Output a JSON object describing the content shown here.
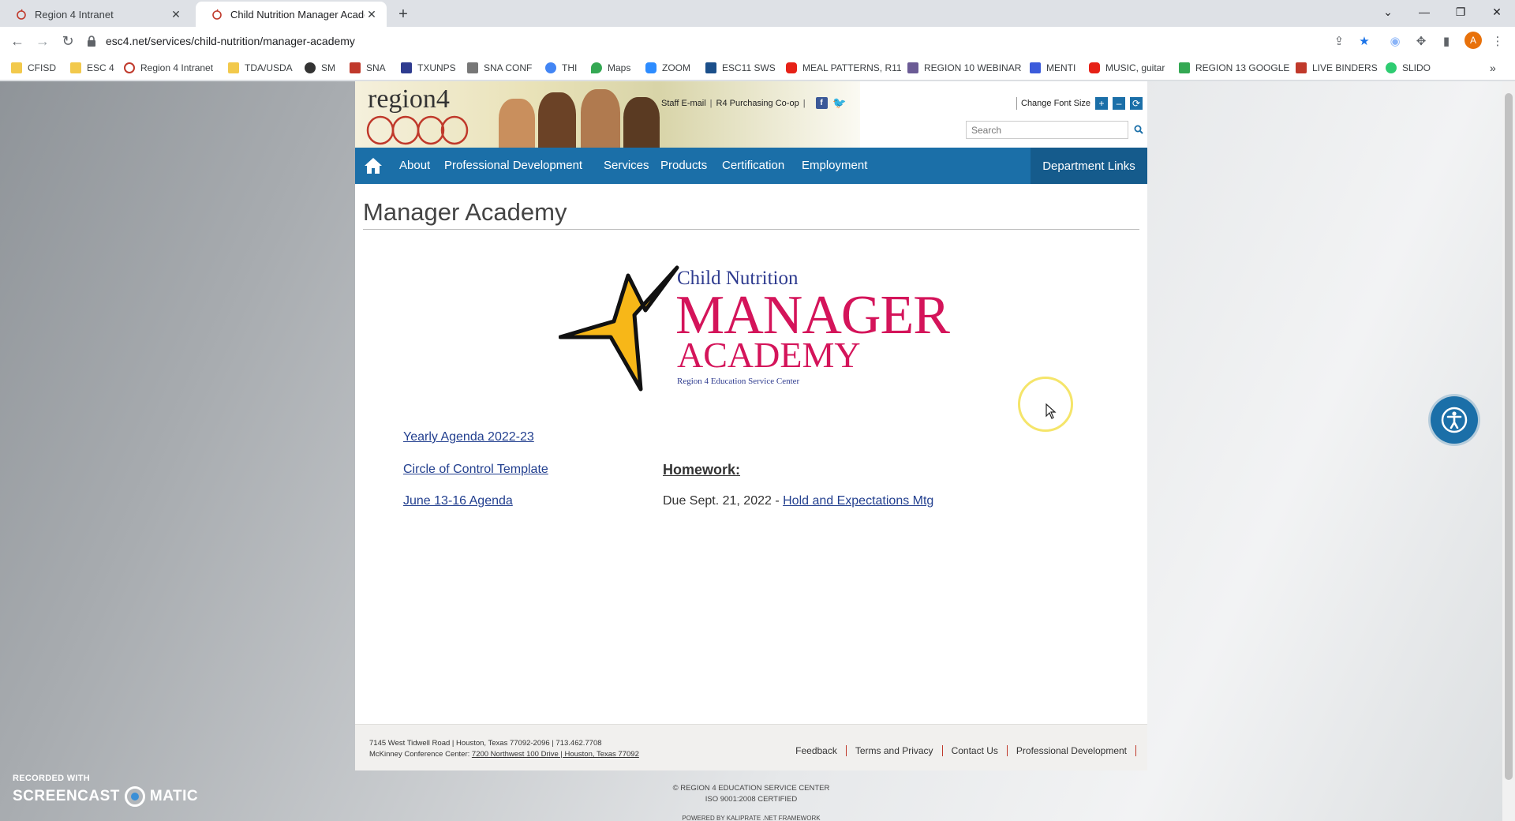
{
  "browser": {
    "tabs": [
      {
        "label": "Region 4 Intranet",
        "close": "✕"
      },
      {
        "label": "Child Nutrition Manager Academ",
        "close": "✕"
      }
    ],
    "new_tab": "+",
    "window_controls": {
      "dropdown": "⌄",
      "minimize": "—",
      "restore": "❐",
      "close": "✕"
    },
    "url": "esc4.net/services/child-nutrition/manager-academy",
    "profile_initial": "A",
    "bookmarks": [
      {
        "label": "CFISD",
        "color": "#f2c94c"
      },
      {
        "label": "ESC 4",
        "color": "#f2c94c"
      },
      {
        "label": "Region 4 Intranet",
        "color": "#c0392b"
      },
      {
        "label": "TDA/USDA",
        "color": "#f2c94c"
      },
      {
        "label": "SM",
        "color": "#333333"
      },
      {
        "label": "SNA",
        "color": "#c0392b"
      },
      {
        "label": "TXUNPS",
        "color": "#2e3b8f"
      },
      {
        "label": "SNA CONF",
        "color": "#555555"
      },
      {
        "label": "THI",
        "color": "#4285f4"
      },
      {
        "label": "Maps",
        "color": "#34a853"
      },
      {
        "label": "ZOOM",
        "color": "#2d8cff"
      },
      {
        "label": "ESC11 SWS",
        "color": "#1b4f8a"
      },
      {
        "label": "MEAL PATTERNS, R11",
        "color": "#e62117"
      },
      {
        "label": "REGION 10 WEBINAR",
        "color": "#6b5b95"
      },
      {
        "label": "MENTI",
        "color": "#3b5bdb"
      },
      {
        "label": "MUSIC, guitar",
        "color": "#e62117"
      },
      {
        "label": "REGION 13 GOOGLE",
        "color": "#34a853"
      },
      {
        "label": "LIVE BINDERS",
        "color": "#c0392b"
      },
      {
        "label": "SLIDO",
        "color": "#2ecc71"
      }
    ],
    "bookmarks_more": "»"
  },
  "site": {
    "logo_text": "region4",
    "top_links": [
      "Staff E-mail",
      "R4 Purchasing Co-op"
    ],
    "change_font_size": "Change Font Size",
    "font_buttons": [
      "+",
      "–",
      "⟳"
    ],
    "search_placeholder": "Search",
    "nav": [
      "About",
      "Professional Development",
      "Services",
      "Products",
      "Certification",
      "Employment"
    ],
    "department_links": "Department Links"
  },
  "main": {
    "title": "Manager Academy",
    "academy_logo": {
      "line1": "Child Nutrition",
      "line2": "MANAGER",
      "line3": "ACADEMY",
      "line4": "Region 4 Education Service Center"
    },
    "links": [
      "Yearly Agenda 2022-23",
      "Circle of Control Template",
      "June 13-16 Agenda"
    ],
    "homework_title": "Homework:",
    "due_text": "Due Sept. 21, 2022 - ",
    "due_link": "Hold and Expectations Mtg"
  },
  "footer": {
    "address_line1": "7145 West Tidwell Road | Houston, Texas 77092-2096 | 713.462.7708",
    "address_line2_prefix": "McKinney Conference Center: ",
    "address_line2_link": "7200 Northwest 100 Drive | Houston, Texas 77092",
    "links": [
      "Feedback",
      "Terms and Privacy",
      "Contact Us",
      "Professional Development"
    ],
    "copyright1": "© REGION 4 EDUCATION SERVICE CENTER",
    "copyright2": "ISO 9001:2008 CERTIFIED",
    "powered": "POWERED BY KALIPRATE .NET FRAMEWORK"
  },
  "watermark": {
    "line1": "RECORDED WITH",
    "line2a": "SCREENCAST",
    "line2b": "MATIC"
  },
  "colors": {
    "nav_blue": "#1b6fa8",
    "academy_red": "#d4145a",
    "academy_blue": "#2e3b8f"
  }
}
